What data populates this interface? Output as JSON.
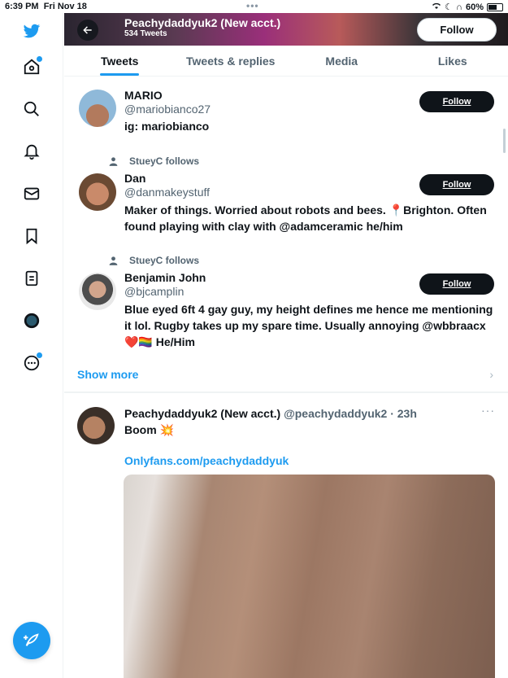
{
  "status_bar": {
    "time": "6:39 PM",
    "date": "Fri Nov 18",
    "battery": "60%",
    "dots": "•••"
  },
  "sidebar": {
    "icons": [
      "twitter-logo-icon",
      "home-icon",
      "search-icon",
      "notifications-icon",
      "messages-icon",
      "bookmarks-icon",
      "lists-icon",
      "profile-icon",
      "more-icon"
    ],
    "compose": "compose-tweet-icon"
  },
  "header": {
    "title": "Peachydaddyuk2 (New acct.)",
    "subtitle": "534 Tweets",
    "follow_label": "Follow"
  },
  "tabs": [
    "Tweets",
    "Tweets & replies",
    "Media",
    "Likes"
  ],
  "users": [
    {
      "social": "",
      "name": "MARIO",
      "handle": "@mariobianco27",
      "bio": "ig: mariobianco",
      "follow": "Follow"
    },
    {
      "social": "StueyC follows",
      "name": "Dan",
      "handle": "@danmakeystuff",
      "bio": "Maker of things. Worried about robots and bees. 📍Brighton. Often found playing with clay with @adamceramic he/him",
      "follow": "Follow"
    },
    {
      "social": "StueyC follows",
      "name": "Benjamin John",
      "handle": "@bjcamplin",
      "bio": "Blue eyed 6ft 4 gay guy, my height defines me hence me mentioning it lol. Rugby takes up my spare time. Usually annoying @wbbraacx ❤️🏳️‍🌈 He/Him",
      "follow": "Follow"
    }
  ],
  "show_more": "Show more",
  "tweet": {
    "name": "Peachydaddyuk2 (New acct.)",
    "meta": "@peachydaddyuk2 · 23h",
    "more": "···",
    "text": "Boom 💥",
    "link": "Onlyfans.com/peachydaddyuk"
  },
  "colors": {
    "accent": "#1d9bf0",
    "text": "#0f1419",
    "secondary": "#536471"
  }
}
